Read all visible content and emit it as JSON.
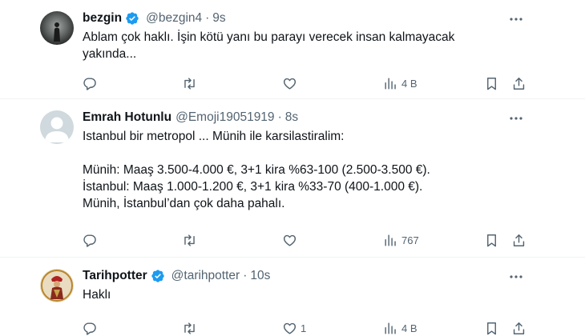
{
  "tweets": [
    {
      "name": "bezgin",
      "verified": true,
      "handle": "@bezgin4",
      "dot": "·",
      "time": "9s",
      "text": "Ablam çok haklı. İşin kötü yanı bu parayı verecek insan kalmayacak\nyakında...",
      "views": "4 B",
      "likes": ""
    },
    {
      "name": "Emrah Hotunlu",
      "verified": false,
      "handle": "@Emoji19051919",
      "dot": "·",
      "time": "8s",
      "text": "Istanbul bir metropol ... Münih ile karsilastiralim:\n\nMünih: Maaş 3.500-4.000 €, 3+1 kira %63-100 (2.500-3.500 €).\nİstanbul: Maaş 1.000-1.200 €, 3+1 kira %33-70 (400-1.000 €).\nMünih, İstanbul’dan çok daha pahalı.",
      "views": "767",
      "likes": ""
    },
    {
      "name": "Tarihpotter",
      "verified": true,
      "handle": "@tarihpotter",
      "dot": "·",
      "time": "10s",
      "text": "Haklı",
      "views": "4 B",
      "likes": "1"
    }
  ],
  "icons": {
    "reply": "reply-icon",
    "retweet": "retweet-icon",
    "like": "like-icon",
    "views": "views-icon",
    "bookmark": "bookmark-icon",
    "share": "share-icon",
    "more": "more-icon",
    "verified": "verified-badge-icon"
  },
  "colors": {
    "verified_blue": "#1d9bf0",
    "secondary_text": "#536471",
    "divider": "#eff3f4"
  }
}
